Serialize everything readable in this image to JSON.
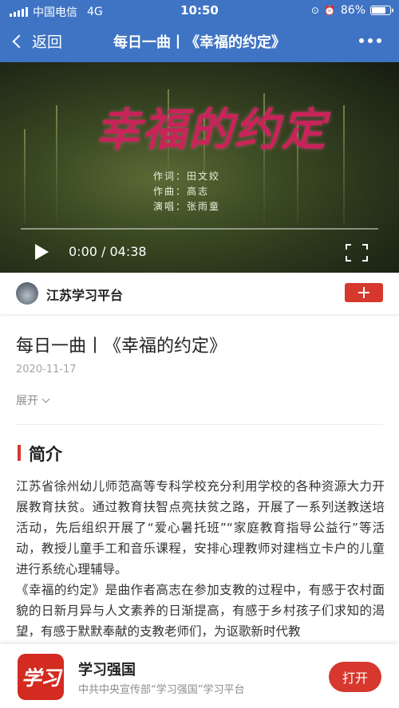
{
  "status_bar": {
    "carrier": "中国电信",
    "network": "4G",
    "time": "10:50",
    "battery": "86%",
    "battery_level": 0.86
  },
  "nav": {
    "back_label": "返回",
    "title": "每日一曲丨《幸福的约定》"
  },
  "video": {
    "title_art": "幸福的约定",
    "credits": [
      "作词：田文姣",
      "作曲：高志",
      "演唱：张雨童"
    ],
    "current_time": "0:00",
    "duration": "04:38",
    "time_display": "0:00 / 04:38"
  },
  "channel": {
    "name": "江苏学习平台"
  },
  "article": {
    "title": "每日一曲丨《幸福的约定》",
    "date": "2020-11-17",
    "expand_label": "展开",
    "section_title": "简介",
    "paragraphs": [
      "江苏省徐州幼儿师范高等专科学校充分利用学校的各种资源大力开展教育扶贫。通过教育扶智点亮扶贫之路，开展了一系列送教送培活动，先后组织开展了“爱心暑托班”“家庭教育指导公益行”等活动，教授儿童手工和音乐课程，安排心理教师对建档立卡户的儿童进行系统心理辅导。",
      "《幸福的约定》是曲作者高志在参加支教的过程中，有感于农村面貌的日新月异与人文素养的日渐提高，有感于乡村孩子们求知的渴望，有感于默默奉献的支教老师们，为讴歌新时代教"
    ]
  },
  "banner": {
    "app_icon_text": "学习",
    "app_name": "学习强国",
    "app_subtitle": "中共中央宣传部“学习强国”学习平台",
    "open_label": "打开"
  }
}
